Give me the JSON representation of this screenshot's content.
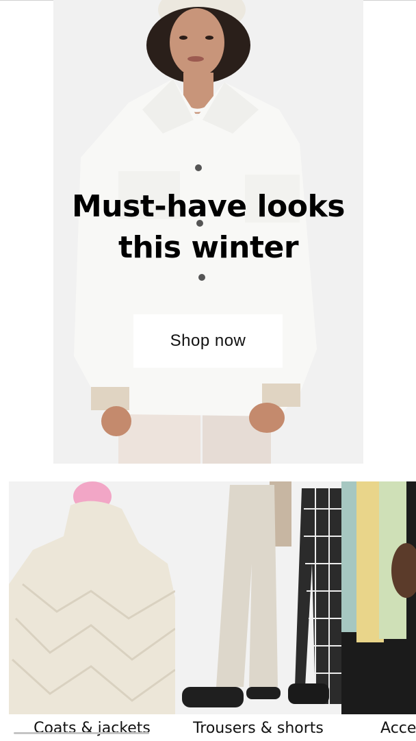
{
  "hero": {
    "title": "Must-have looks this winter",
    "button_label": "Shop now"
  },
  "categories": [
    {
      "label": "Coats & jackets",
      "image_icon": "coat-photo"
    },
    {
      "label": "Trousers & shorts",
      "image_icon": "trousers-photo"
    },
    {
      "label": "Accessories",
      "image_icon": "accessories-photo"
    }
  ],
  "colors": {
    "hero_background": "#f1f1f1",
    "button_background": "#ffffff",
    "text": "#000000"
  }
}
